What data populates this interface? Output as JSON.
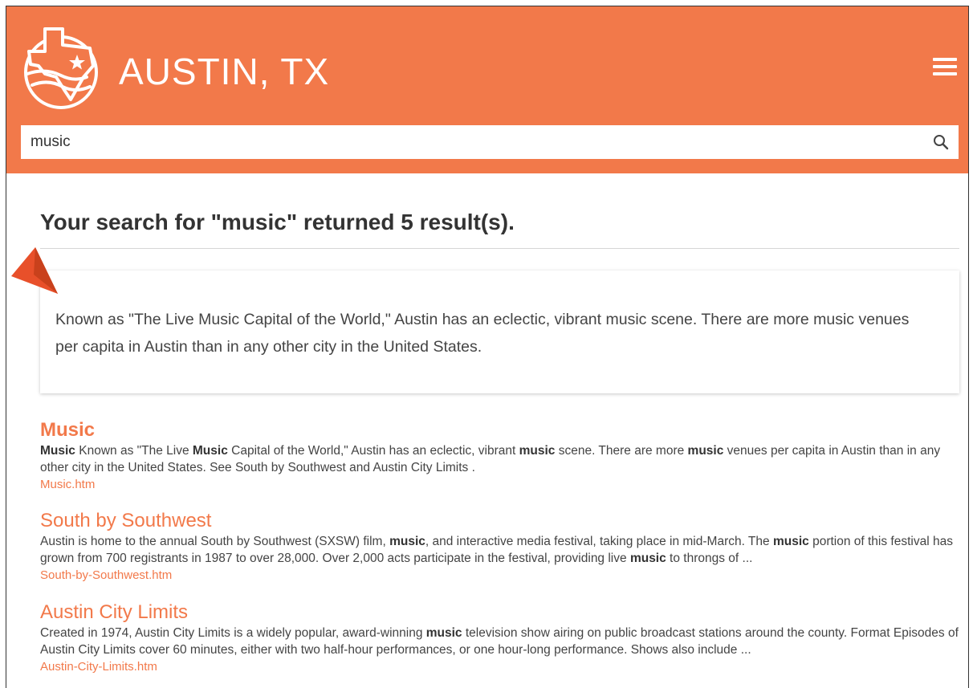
{
  "header": {
    "site_title": "AUSTIN, TX",
    "logo_icon": "texas-map-logo-icon",
    "menu_icon": "hamburger-menu-icon"
  },
  "search": {
    "value": "music",
    "placeholder": "",
    "button_icon": "search-icon"
  },
  "results": {
    "heading": "Your search for \"music\" returned 5 result(s).",
    "abstract": "Known as \"The Live Music Capital of the World,\" Austin has an eclectic, vibrant music scene. There are more music venues per capita in Austin than in any other city in the United States.",
    "items": [
      {
        "title": "Music",
        "snippet": [
          {
            "b": "Music"
          },
          {
            "t": " Known as \"The Live "
          },
          {
            "b": "Music"
          },
          {
            "t": " Capital of the World,\" Austin has an eclectic, vibrant "
          },
          {
            "b": "music"
          },
          {
            "t": " scene. There are more "
          },
          {
            "b": "music"
          },
          {
            "t": " venues per capita in Austin than in any other city in the United States. See South by Southwest and Austin City Limits ."
          }
        ],
        "url": "Music.htm"
      },
      {
        "title": "South by Southwest",
        "snippet": [
          {
            "t": "Austin is home to the annual South by Southwest (SXSW) film, "
          },
          {
            "b": "music"
          },
          {
            "t": ", and interactive media festival, taking place in mid-March. The "
          },
          {
            "b": "music"
          },
          {
            "t": " portion of this festival has grown from 700 registrants in 1987 to over 28,000. Over 2,000 acts participate in the festival, providing live "
          },
          {
            "b": "music"
          },
          {
            "t": " to throngs of ..."
          }
        ],
        "url": "South-by-Southwest.htm"
      },
      {
        "title": "Austin City Limits",
        "snippet": [
          {
            "t": "Created in 1974, Austin City Limits is a widely popular, award-winning "
          },
          {
            "b": "music"
          },
          {
            "t": " television show airing on public broadcast stations around the county. Format Episodes of Austin City Limits cover 60 minutes, either with two half-hour performances, or one hour-long performance. Shows also include ..."
          }
        ],
        "url": "Austin-City-Limits.htm"
      }
    ]
  },
  "colors": {
    "brand_orange": "#f2794a",
    "pointer_red": "#e8502a"
  }
}
